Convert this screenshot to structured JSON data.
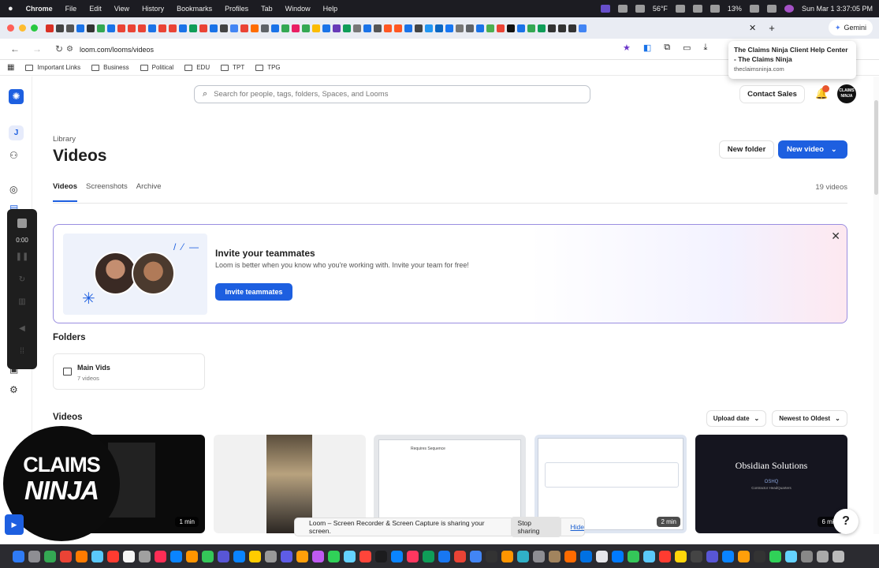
{
  "menubar": {
    "apple": "",
    "items": [
      "Chrome",
      "File",
      "Edit",
      "View",
      "History",
      "Bookmarks",
      "Profiles",
      "Tab",
      "Window",
      "Help"
    ],
    "weather": "56°F",
    "battery": "13%",
    "clock": "Sun Mar 1  3:37:05 PM"
  },
  "browser": {
    "gemini_label": "Gemini",
    "url": "loom.com/looms/videos",
    "tab_colors": [
      "#d93025",
      "#444",
      "#555",
      "#1a73e8",
      "#333",
      "#34a853",
      "#1a73e8",
      "#ea4335",
      "#ea4335",
      "#ea4335",
      "#1a73e8",
      "#ea4335",
      "#ea4335",
      "#1a73e8",
      "#0f9d58",
      "#ea4335",
      "#1a73e8",
      "#444",
      "#4285f4",
      "#ea4335",
      "#ff6d01",
      "#5f6368",
      "#1a73e8",
      "#34a853",
      "#e91e63",
      "#34a853",
      "#fbbc04",
      "#1a73e8",
      "#673ab7",
      "#0f9d58",
      "#777",
      "#1a73e8",
      "#555",
      "#ff5722",
      "#ff5722",
      "#1a73e8",
      "#444",
      "#2196f3",
      "#0a66c2",
      "#1877f2",
      "#777",
      "#5f6368",
      "#1a73e8",
      "#4caf50",
      "#ea4335",
      "#111",
      "#1a73e8",
      "#34a853",
      "#0f9d58",
      "#333",
      "#333",
      "#333",
      "#4285f4"
    ]
  },
  "bookmarks": [
    "Important Links",
    "Business",
    "Political",
    "EDU",
    "TPT",
    "TPG"
  ],
  "tooltip": {
    "title": "The Claims Ninja Client Help Center - The Claims Ninja",
    "domain": "theclaimsninja.com"
  },
  "sidebar": {
    "avatar_letter": "J"
  },
  "recorder": {
    "timer": "0:00"
  },
  "header": {
    "search_placeholder": "Search for people, tags, folders, Spaces, and Looms",
    "contact_sales": "Contact Sales",
    "notification_count": "",
    "profile_text": "CLAIMS NINJA"
  },
  "page": {
    "breadcrumb": "Library",
    "title": "Videos",
    "new_folder": "New folder",
    "new_video": "New video",
    "tabs": [
      "Videos",
      "Screenshots",
      "Archive"
    ],
    "video_count": "19 videos"
  },
  "invite": {
    "heading": "Invite your teammates",
    "body": "Loom is better when you know who you're working with. Invite your team for free!",
    "button": "Invite teammates"
  },
  "folders": {
    "heading": "Folders",
    "items": [
      {
        "name": "Main Vids",
        "count": "7 videos"
      }
    ]
  },
  "videos": {
    "heading": "Videos",
    "sort_field": "Upload date",
    "sort_order": "Newest to Oldest",
    "cards": [
      {
        "duration": "1 min"
      },
      {
        "duration": ""
      },
      {
        "duration": "",
        "doc_heading": "Requires Sequence"
      },
      {
        "duration": "2 min"
      },
      {
        "duration": "6 min",
        "title": "Obsidian Solutions",
        "subtitle": "OSHQ",
        "subtitle2": "Contractor HeadQuarters"
      }
    ]
  },
  "overlay": {
    "line1": "CLAIMS",
    "line2": "NINJA"
  },
  "sharing": {
    "message": "Loom – Screen Recorder & Screen Capture is sharing your screen.",
    "stop": "Stop sharing",
    "hide": "Hide"
  },
  "help_label": "?",
  "dock_colors": [
    "#2f7bf5",
    "#8e8e93",
    "#34a853",
    "#ea4335",
    "#ff7b00",
    "#5ac8fa",
    "#ff3b30",
    "#f5f5f5",
    "#a0a0a0",
    "#ff2d55",
    "#0a84ff",
    "#ff9500",
    "#34c759",
    "#5856d6",
    "#0a84ff",
    "#ffcc00",
    "#999",
    "#5e5ce6",
    "#ff9f0a",
    "#bf5af2",
    "#30d158",
    "#64d2ff",
    "#ff453a",
    "#1c1c1e",
    "#0a84ff",
    "#ff375f",
    "#0f9d58",
    "#1877f2",
    "#ea4335",
    "#4285f4",
    "#333",
    "#ff9500",
    "#30b0c7",
    "#8e8e93",
    "#a2845e",
    "#ff6b00",
    "#0071e3",
    "#e5e5ea",
    "#007aff",
    "#34c759",
    "#5ac8fa",
    "#ff3b30",
    "#ffd60a",
    "#444",
    "#5856d6",
    "#0a84ff",
    "#ff9f0a",
    "#333",
    "#30d158",
    "#64d2ff",
    "#888",
    "#aaa",
    "#bbb"
  ]
}
